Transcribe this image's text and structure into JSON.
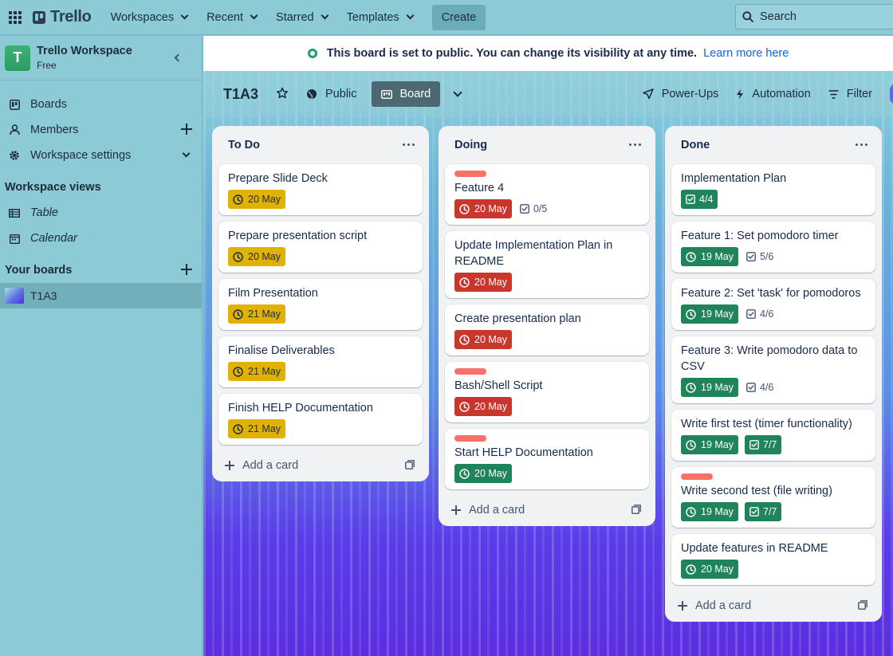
{
  "topbar": {
    "logo": "Trello",
    "nav": [
      {
        "label": "Workspaces"
      },
      {
        "label": "Recent"
      },
      {
        "label": "Starred"
      },
      {
        "label": "Templates"
      }
    ],
    "create_label": "Create",
    "search_placeholder": "Search"
  },
  "sidebar": {
    "workspace_initial": "T",
    "workspace_name": "Trello Workspace",
    "workspace_plan": "Free",
    "items": [
      {
        "label": "Boards"
      },
      {
        "label": "Members"
      },
      {
        "label": "Workspace settings"
      }
    ],
    "views_heading": "Workspace views",
    "views": [
      {
        "label": "Table"
      },
      {
        "label": "Calendar"
      }
    ],
    "boards_heading": "Your boards",
    "boards": [
      {
        "label": "T1A3"
      }
    ]
  },
  "banner": {
    "message": "This board is set to public. You can change its visibility at any time.",
    "link": "Learn more here"
  },
  "board": {
    "title": "T1A3",
    "visibility": "Public",
    "view_label": "Board",
    "actions": [
      {
        "label": "Power-Ups"
      },
      {
        "label": "Automation"
      },
      {
        "label": "Filter"
      }
    ]
  },
  "lists": [
    {
      "title": "To Do",
      "add_label": "Add a card",
      "cards": [
        {
          "title": "Prepare Slide Deck",
          "label": false,
          "due": "20 May",
          "due_status": "yellow",
          "checklist": null
        },
        {
          "title": "Prepare presentation script",
          "label": false,
          "due": "20 May",
          "due_status": "yellow",
          "checklist": null
        },
        {
          "title": "Film Presentation",
          "label": false,
          "due": "21 May",
          "due_status": "yellow",
          "checklist": null
        },
        {
          "title": "Finalise Deliverables",
          "label": false,
          "due": "21 May",
          "due_status": "yellow",
          "checklist": null
        },
        {
          "title": "Finish HELP Documentation",
          "label": false,
          "due": "21 May",
          "due_status": "yellow",
          "checklist": null
        }
      ]
    },
    {
      "title": "Doing",
      "add_label": "Add a card",
      "cards": [
        {
          "title": "Feature 4",
          "label": true,
          "due": "20 May",
          "due_status": "red",
          "checklist": "0/5",
          "checklist_complete": false
        },
        {
          "title": "Update Implementation Plan in README",
          "label": false,
          "due": "20 May",
          "due_status": "red",
          "checklist": null
        },
        {
          "title": "Create presentation plan",
          "label": false,
          "due": "20 May",
          "due_status": "red",
          "checklist": null
        },
        {
          "title": "Bash/Shell Script",
          "label": true,
          "due": "20 May",
          "due_status": "red",
          "checklist": null
        },
        {
          "title": "Start HELP Documentation",
          "label": true,
          "due": "20 May",
          "due_status": "green",
          "checklist": null
        }
      ]
    },
    {
      "title": "Done",
      "add_label": "Add a card",
      "cards": [
        {
          "title": "Implementation Plan",
          "label": false,
          "due": null,
          "due_status": null,
          "checklist": "4/4",
          "checklist_complete": true
        },
        {
          "title": "Feature 1: Set pomodoro timer",
          "label": false,
          "due": "19 May",
          "due_status": "green",
          "checklist": "5/6",
          "checklist_complete": false
        },
        {
          "title": "Feature 2: Set 'task' for pomodoros",
          "label": false,
          "due": "19 May",
          "due_status": "green",
          "checklist": "4/6",
          "checklist_complete": false
        },
        {
          "title": "Feature 3: Write pomodoro data to CSV",
          "label": false,
          "due": "19 May",
          "due_status": "green",
          "checklist": "4/6",
          "checklist_complete": false
        },
        {
          "title": "Write first test (timer functionality)",
          "label": false,
          "due": "19 May",
          "due_status": "green",
          "checklist": "7/7",
          "checklist_complete": true
        },
        {
          "title": "Write second test (file writing)",
          "label": true,
          "due": "19 May",
          "due_status": "green",
          "checklist": "7/7",
          "checklist_complete": true
        },
        {
          "title": "Update features in README",
          "label": false,
          "due": "20 May",
          "due_status": "green",
          "checklist": null
        }
      ]
    }
  ],
  "colors": {
    "due_yellow": "#e2b203",
    "due_red": "#c9372c",
    "due_green": "#1f845a",
    "label_red": "#f87168",
    "link_blue": "#0c66e4"
  }
}
